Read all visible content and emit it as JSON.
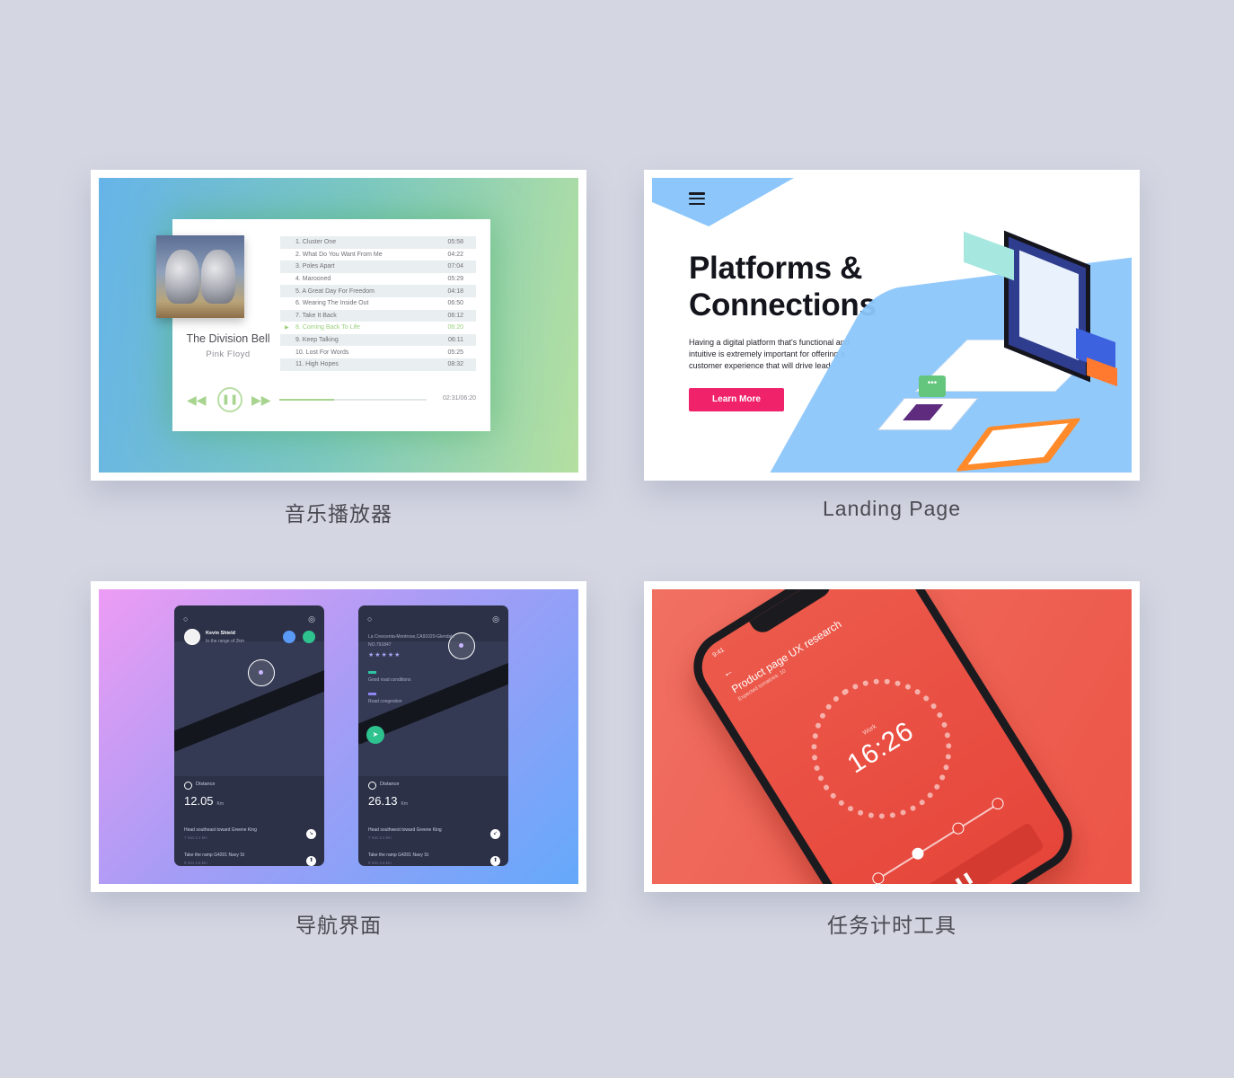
{
  "cards": {
    "music": {
      "caption": "音乐播放器",
      "album_title": "The Division Bell",
      "album_artist": "Pink Floyd",
      "tracks": [
        {
          "label": "1. Cluster One",
          "time": "05:58"
        },
        {
          "label": "2. What Do You Want From Me",
          "time": "04:22"
        },
        {
          "label": "3. Poles Apart",
          "time": "07:04"
        },
        {
          "label": "4. Marooned",
          "time": "05:29"
        },
        {
          "label": "5. A Great Day For Freedom",
          "time": "04:18"
        },
        {
          "label": "6. Wearing The Inside Out",
          "time": "06:50"
        },
        {
          "label": "7. Take It Back",
          "time": "06:12"
        },
        {
          "label": "8. Coming Back To Life",
          "time": "06:20"
        },
        {
          "label": "9. Keep Talking",
          "time": "06:11"
        },
        {
          "label": "10. Lost For Words",
          "time": "05:25"
        },
        {
          "label": "11. High Hopes",
          "time": "08:32"
        }
      ],
      "active_track": 8,
      "elapsed": "02:31/06:20",
      "progress": 0.37,
      "icons": {
        "prev": "◀◀",
        "pause": "❚❚",
        "next": "▶▶",
        "playing": "▶"
      },
      "accent": "#a7d48e"
    },
    "landing": {
      "caption": "Landing Page",
      "title_line1": "Platforms &",
      "title_line2": "Connections",
      "body": "Having a digital platform that's functional and intuitive is extremely important for offering a customer experience that will drive lead",
      "button": "Learn More",
      "button_color": "#f0226a",
      "chat_icon": "•••"
    },
    "navigation": {
      "caption": "导航界面",
      "phone1": {
        "user_name": "Kevin Shield",
        "user_sub": "In the range of 2km",
        "distance_label": "Distance",
        "distance": "12.05",
        "unit": "Km",
        "steps": [
          {
            "text": "Head southeast toward Greene King",
            "sub": "7 min  2.1 km",
            "icon": "↘"
          },
          {
            "text": "Take the ramp G4201 Navy St",
            "sub": "9 min  4.6 km",
            "icon": "⬆"
          }
        ]
      },
      "phone2": {
        "address": "La Crescenta-Montrose,CA91020-Glendale",
        "number": "NO.791847",
        "stars": "★★★★★",
        "condition1": "Good road conditions",
        "condition2": "Road congestion",
        "distance_label": "Distance",
        "distance": "26.13",
        "unit": "Km",
        "steps": [
          {
            "text": "Head southwest toward Greene King",
            "sub": "7 min  2.1 km",
            "icon": "↙"
          },
          {
            "text": "Take the ramp G4201 Navy St",
            "sub": "9 min  4.6 km",
            "icon": "⬆"
          }
        ]
      },
      "icons": {
        "search": "○",
        "settings": "◎",
        "arrow": "➤"
      }
    },
    "timer": {
      "caption": "任务计时工具",
      "status_time": "9:41",
      "back": "←",
      "title": "Product page UX research",
      "subtitle": "Expected tomatoes: 10",
      "mode": "Work",
      "time": "16:26",
      "pause": "❚❚"
    }
  }
}
